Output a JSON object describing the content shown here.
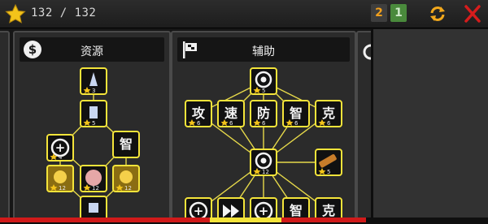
{
  "header": {
    "star_count": "132 / 132",
    "counter_orange": "2",
    "counter_green": "1"
  },
  "panels": {
    "resources_title": "资源",
    "support_title": "辅助"
  },
  "nodes": {
    "res": [
      {
        "glyph": "",
        "stars": "3",
        "kind": "icon-rocket"
      },
      {
        "glyph": "",
        "stars": "5",
        "kind": "icon-tower"
      },
      {
        "glyph": "+",
        "stars": "4",
        "kind": "icon-plus"
      },
      {
        "glyph": "智",
        "stars": "",
        "kind": "char"
      },
      {
        "glyph": "",
        "stars": "12",
        "kind": "icon-gold"
      },
      {
        "glyph": "",
        "stars": "12",
        "kind": "icon-pink"
      },
      {
        "glyph": "",
        "stars": "12",
        "kind": "icon-goldball"
      },
      {
        "glyph": "",
        "stars": "",
        "kind": "icon-bottom"
      }
    ],
    "aux": [
      {
        "glyph": "",
        "stars": "5",
        "kind": "icon-disc"
      },
      {
        "glyph": "攻",
        "stars": "6",
        "kind": "char"
      },
      {
        "glyph": "速",
        "stars": "6",
        "kind": "char"
      },
      {
        "glyph": "防",
        "stars": "6",
        "kind": "char"
      },
      {
        "glyph": "智",
        "stars": "6",
        "kind": "char"
      },
      {
        "glyph": "克",
        "stars": "6",
        "kind": "char"
      },
      {
        "glyph": "",
        "stars": "12",
        "kind": "icon-gear"
      },
      {
        "glyph": "",
        "stars": "5",
        "kind": "icon-cannon"
      },
      {
        "glyph": "+",
        "stars": "",
        "kind": "icon-plus"
      },
      {
        "glyph": "",
        "stars": "",
        "kind": "icon-ff"
      },
      {
        "glyph": "+",
        "stars": "",
        "kind": "icon-plus"
      },
      {
        "glyph": "智",
        "stars": "",
        "kind": "char"
      },
      {
        "glyph": "克",
        "stars": "",
        "kind": "char"
      }
    ]
  },
  "colors": {
    "accent_yellow": "#f4e43a",
    "node_bg": "#111111",
    "line": "#e6d94a",
    "red": "#d11a1a",
    "green": "#4a8a3c"
  },
  "icons": {
    "star": "star-icon",
    "refresh": "refresh-icon",
    "close": "close-icon",
    "dollar": "dollar-icon",
    "flag": "flag-icon"
  }
}
